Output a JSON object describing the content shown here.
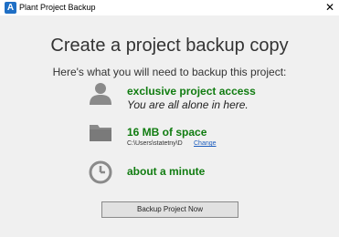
{
  "window": {
    "title": "Plant Project Backup",
    "app_icon": "autodesk-a-icon",
    "app_icon_letter": "A",
    "close_glyph": "✕"
  },
  "main": {
    "heading": "Create a project backup copy",
    "subheading": "Here's what you will need to backup this project:",
    "requirements": [
      {
        "icon": "person-icon",
        "title": "exclusive project access",
        "detail": "You are all alone in here."
      },
      {
        "icon": "folder-icon",
        "title": "16 MB of space",
        "path": "C:\\Users\\statetny\\D",
        "link_label": "Change"
      },
      {
        "icon": "clock-icon",
        "title": "about a minute"
      }
    ],
    "primary_button": "Backup Project Now"
  },
  "colors": {
    "accent_green": "#107c10",
    "link_blue": "#1f5fbf",
    "icon_gray": "#8a8a8a"
  }
}
